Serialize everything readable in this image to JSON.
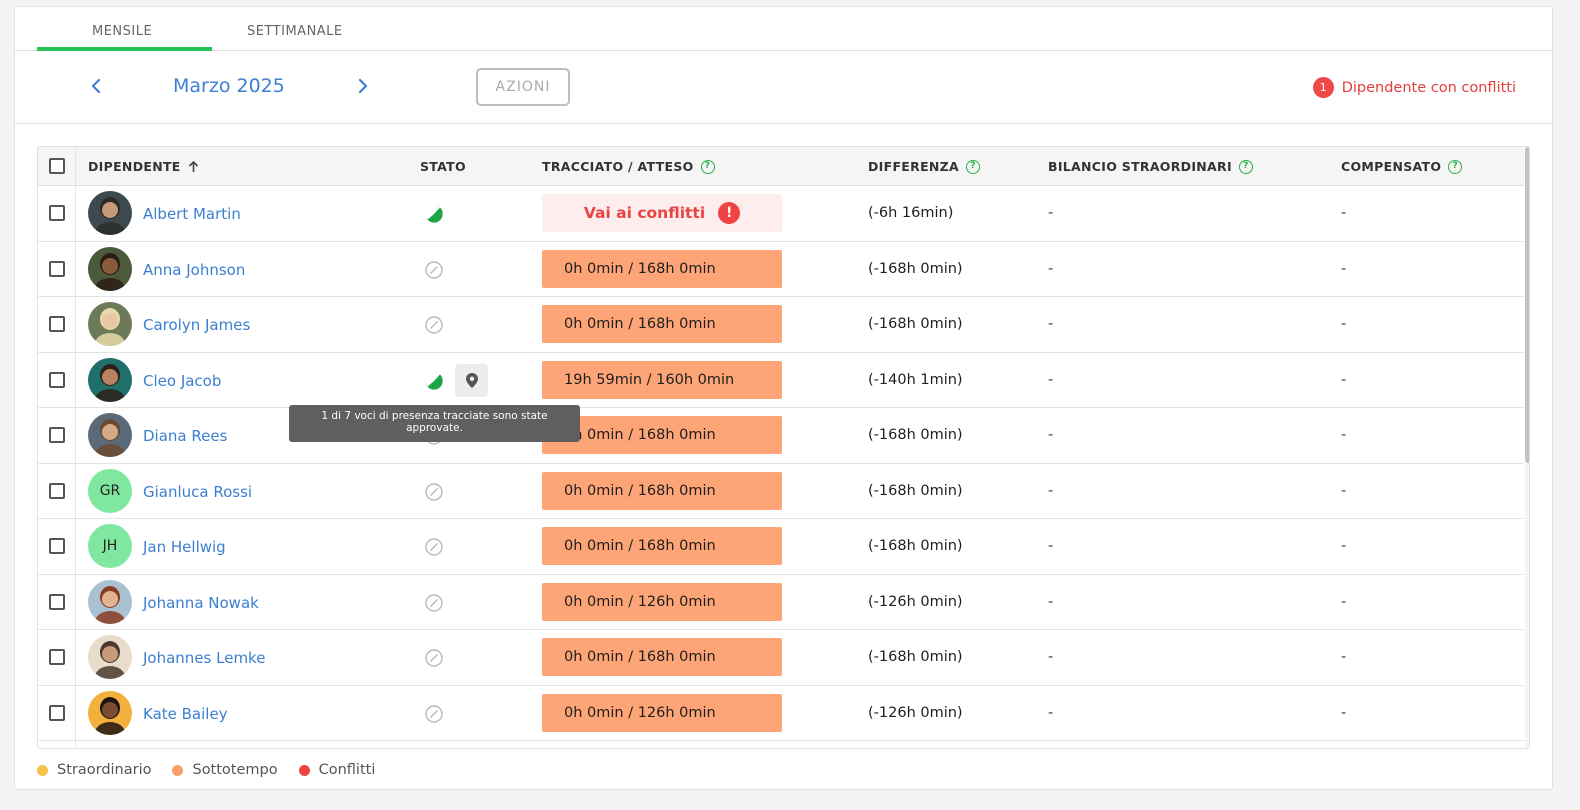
{
  "tabs": [
    {
      "label": "MENSILE",
      "active": true
    },
    {
      "label": "SETTIMANALE",
      "active": false
    }
  ],
  "toolbar": {
    "month": "Marzo 2025",
    "actions_label": "AZIONI",
    "conflict_count": "1",
    "conflict_label": "Dipendente con conflitti"
  },
  "columns": {
    "employee": "DIPENDENTE",
    "status": "STATO",
    "tracked": "TRACCIATO / ATTESO",
    "difference": "DIFFERENZA",
    "overtime_balance": "BILANCIO STRAORDINARI",
    "compensated": "COMPENSATO",
    "help_glyph": "?"
  },
  "rows": [
    {
      "name": "Albert Martin",
      "avatar": "photo",
      "status": "partially-approved",
      "tracked": "Vai ai conflitti",
      "tracked_type": "conflict",
      "alert_glyph": "!",
      "diff": "(-6h 16min)",
      "balance": "-",
      "compensated": "-"
    },
    {
      "name": "Anna Johnson",
      "avatar": "photo",
      "status": "none",
      "tracked": "0h 0min / 168h 0min",
      "tracked_type": "undertime",
      "diff": "(-168h 0min)",
      "balance": "-",
      "compensated": "-"
    },
    {
      "name": "Carolyn James",
      "avatar": "photo",
      "status": "none",
      "tracked": "0h 0min / 168h 0min",
      "tracked_type": "undertime",
      "diff": "(-168h 0min)",
      "balance": "-",
      "compensated": "-"
    },
    {
      "name": "Cleo Jacob",
      "avatar": "photo",
      "status": "partially-approved",
      "location": true,
      "tracked": "19h 59min / 160h 0min",
      "tracked_type": "undertime",
      "diff": "(-140h 1min)",
      "balance": "-",
      "compensated": "-"
    },
    {
      "name": "Diana Rees",
      "avatar": "photo",
      "status": "none",
      "tracked": "0h 0min / 168h 0min",
      "tracked_type": "undertime",
      "diff": "(-168h 0min)",
      "balance": "-",
      "compensated": "-"
    },
    {
      "name": "Gianluca Rossi",
      "avatar": "initials",
      "initials": "GR",
      "status": "none",
      "tracked": "0h 0min / 168h 0min",
      "tracked_type": "undertime",
      "diff": "(-168h 0min)",
      "balance": "-",
      "compensated": "-"
    },
    {
      "name": "Jan Hellwig",
      "avatar": "initials",
      "initials": "JH",
      "status": "none",
      "tracked": "0h 0min / 168h 0min",
      "tracked_type": "undertime",
      "diff": "(-168h 0min)",
      "balance": "-",
      "compensated": "-"
    },
    {
      "name": "Johanna Nowak",
      "avatar": "photo",
      "status": "none",
      "tracked": "0h 0min / 126h 0min",
      "tracked_type": "undertime",
      "diff": "(-126h 0min)",
      "balance": "-",
      "compensated": "-"
    },
    {
      "name": "Johannes Lemke",
      "avatar": "photo",
      "status": "none",
      "tracked": "0h 0min / 168h 0min",
      "tracked_type": "undertime",
      "diff": "(-168h 0min)",
      "balance": "-",
      "compensated": "-"
    },
    {
      "name": "Kate Bailey",
      "avatar": "photo",
      "status": "none",
      "tracked": "0h 0min / 126h 0min",
      "tracked_type": "undertime",
      "diff": "(-126h 0min)",
      "balance": "-",
      "compensated": "-"
    }
  ],
  "tooltip": "1 di 7 voci di presenza tracciate sono state approvate.",
  "legend": [
    {
      "label": "Straordinario",
      "color": "#f6c04d"
    },
    {
      "label": "Sottotempo",
      "color": "#f9a06b"
    },
    {
      "label": "Conflitti",
      "color": "#ef4343"
    }
  ]
}
